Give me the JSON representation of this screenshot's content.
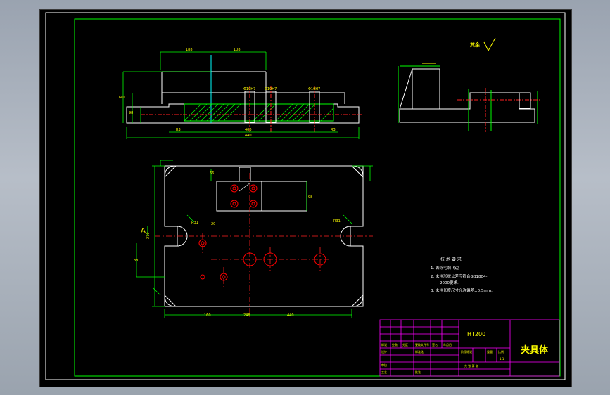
{
  "drawing": {
    "title": "夹具体",
    "material": "HT200",
    "roughness_label": "其余",
    "section_mark": "A",
    "tech_requirements": {
      "heading": "技 术 要 求",
      "items": [
        "1. 去除毛刺飞边",
        "2. 未注形状公差应符合GB1804-",
        "2000要求.",
        "3. 未注长度尺寸允许偏差±0.5mm."
      ]
    },
    "title_block": {
      "cells": [
        "标记",
        "处数",
        "分区",
        "更改文件号",
        "签名",
        "年月日",
        "设计",
        "标准化",
        "阶段标记",
        "重量",
        "比例",
        "审核",
        "工艺",
        "批准",
        "共 张 第 张",
        "1:1"
      ]
    },
    "dimensions": {
      "top_view": [
        "188",
        "108",
        "140",
        "98",
        "R3",
        "R3",
        "Φ10H7",
        "Φ10H7",
        "Φ10H7",
        "440",
        "400"
      ],
      "plan_view": [
        "270",
        "160",
        "248",
        "440",
        "38",
        "98",
        "R31",
        "R31",
        "20",
        "66"
      ]
    }
  },
  "colors": {
    "outline": "#ffffff",
    "dimension": "#00ff00",
    "text": "#ffff00",
    "centerline": "#ff2020",
    "frame": "#00ff00",
    "hatch": "#00ff00",
    "titleblock": "#ff00ff",
    "hole": "#ff0000",
    "lead": "#00ffff"
  }
}
